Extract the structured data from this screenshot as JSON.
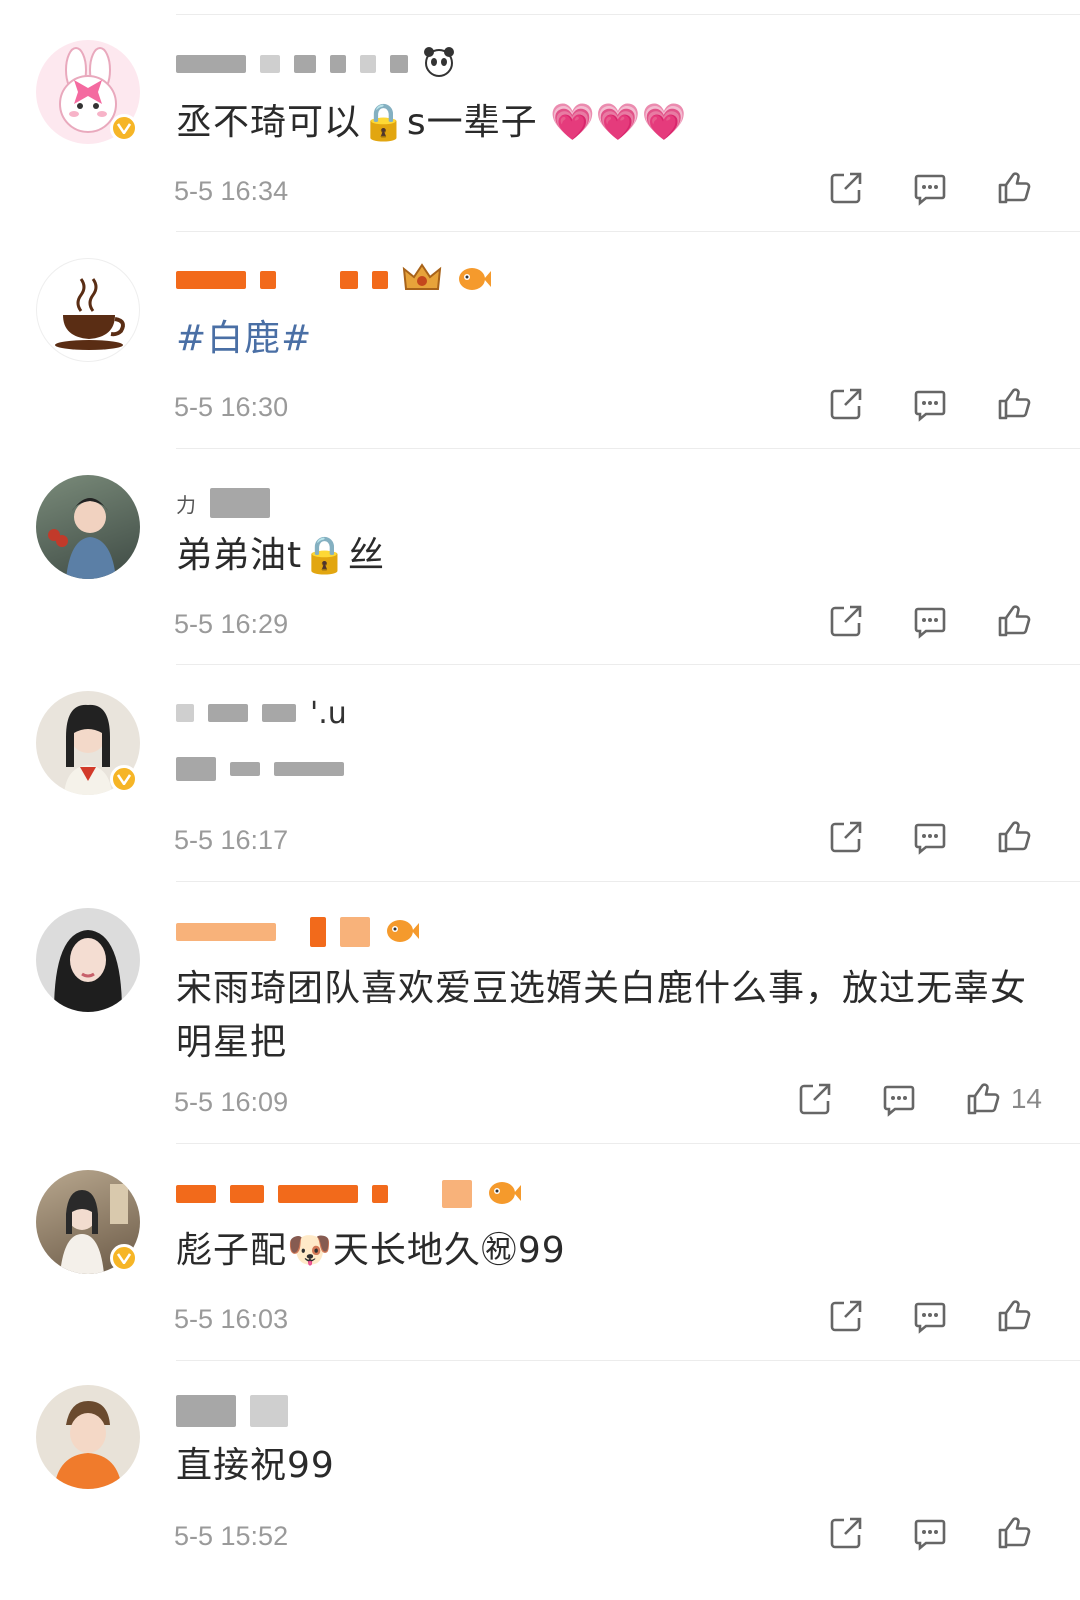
{
  "comments": [
    {
      "content": "丞不琦可以🔒s一辈子 💗💗💗",
      "time": "5-5 16:34",
      "like_count": "",
      "verified": true,
      "avatar": "bunny-avatar"
    },
    {
      "content": "#白鹿#",
      "time": "5-5 16:30",
      "like_count": "",
      "verified": false,
      "avatar": "coffee-avatar"
    },
    {
      "content": "弟弟油t🔒丝",
      "time": "5-5 16:29",
      "like_count": "",
      "verified": false,
      "avatar": "portrait-avatar"
    },
    {
      "username_fragment": "'.u",
      "content": "",
      "time": "5-5 16:17",
      "like_count": "",
      "verified": true,
      "avatar": "girl-avatar"
    },
    {
      "content": "宋雨琦团队喜欢爱豆选婿关白鹿什么事，放过无辜女明星把",
      "time": "5-5 16:09",
      "like_count": "14",
      "verified": false,
      "avatar": "woman-avatar"
    },
    {
      "content": "彪子配🐶天长地久㊗99",
      "time": "5-5 16:03",
      "like_count": "",
      "verified": true,
      "avatar": "drama-avatar"
    },
    {
      "content": "直接祝99",
      "time": "5-5 15:52",
      "like_count": "",
      "verified": false,
      "avatar": "boy-avatar"
    }
  ],
  "colors": {
    "topic_link": "#4a6fa5",
    "timestamp": "#9a9a9a",
    "verified_badge": "#f6b526",
    "vip_name": "#f26a1b"
  },
  "icons": [
    "share-icon",
    "comment-icon",
    "like-icon",
    "verified-icon"
  ]
}
